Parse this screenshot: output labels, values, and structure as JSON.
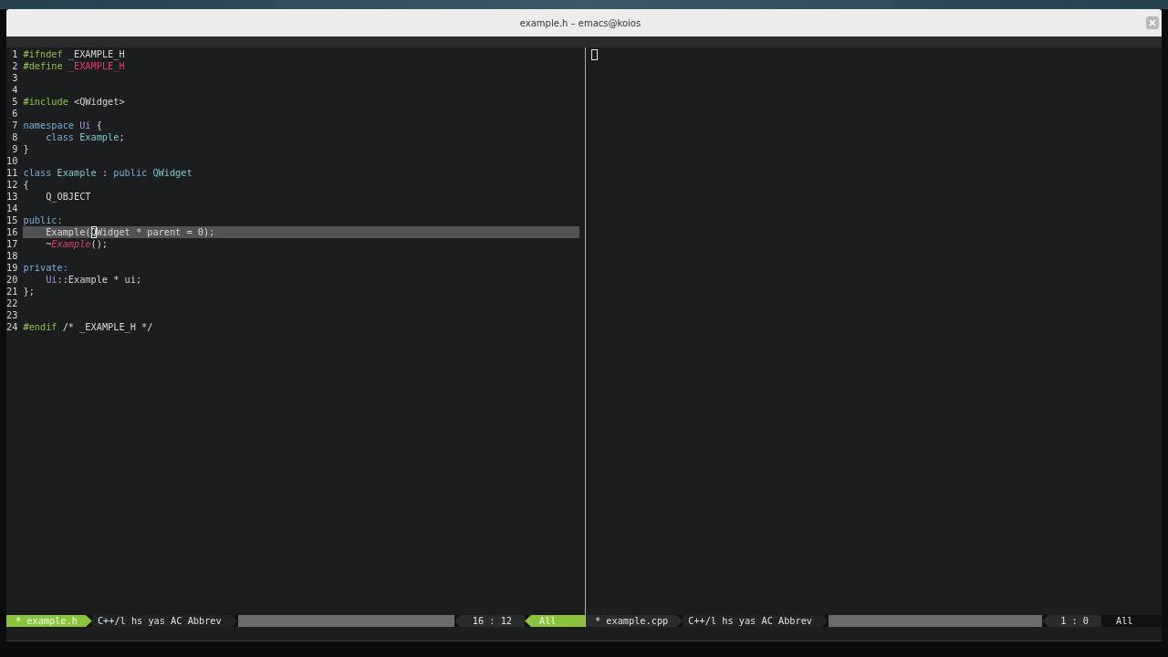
{
  "window": {
    "title": "example.h – emacs@koios"
  },
  "panes": [
    {
      "active": true,
      "lines": [
        {
          "number": "1",
          "indented": false,
          "current": false,
          "tokens": [
            {
              "kind": "preproc",
              "text": "#ifndef"
            },
            {
              "kind": "plain",
              "text": " _EXAMPLE_H"
            }
          ]
        },
        {
          "number": "2",
          "indented": false,
          "current": false,
          "tokens": [
            {
              "kind": "preproc",
              "text": "#define"
            },
            {
              "kind": "constant",
              "text": " _EXAMPLE_H"
            }
          ]
        },
        {
          "number": "3",
          "current": false
        },
        {
          "number": "4",
          "current": false
        },
        {
          "number": "5",
          "indented": false,
          "current": false,
          "tokens": [
            {
              "kind": "preproc",
              "text": "#include"
            },
            {
              "kind": "plain",
              "text": " <QWidget>"
            }
          ]
        },
        {
          "number": "6",
          "current": false
        },
        {
          "number": "7",
          "indented": false,
          "current": false,
          "tokens": [
            {
              "kind": "keyword",
              "text": "namespace"
            },
            {
              "kind": "namespace",
              "text": " Ui"
            },
            {
              "kind": "plain",
              "text": " {"
            }
          ]
        },
        {
          "number": "8",
          "indented": true,
          "current": false,
          "tokens": [
            {
              "kind": "keyword",
              "text": "class"
            },
            {
              "kind": "type",
              "text": " Example"
            },
            {
              "kind": "plain",
              "text": ";"
            }
          ]
        },
        {
          "number": "9",
          "indented": false,
          "current": false,
          "tokens": [
            {
              "kind": "plain",
              "text": "}"
            }
          ]
        },
        {
          "number": "10",
          "current": false
        },
        {
          "number": "11",
          "indented": false,
          "current": false,
          "tokens": [
            {
              "kind": "keyword",
              "text": "class"
            },
            {
              "kind": "type",
              "text": " Example"
            },
            {
              "kind": "plain",
              "text": " :"
            },
            {
              "kind": "keyword",
              "text": " public"
            },
            {
              "kind": "type",
              "text": " QWidget"
            }
          ]
        },
        {
          "number": "12",
          "indented": false,
          "current": false,
          "tokens": [
            {
              "kind": "plain",
              "text": "{"
            }
          ]
        },
        {
          "number": "13",
          "indented": true,
          "current": false,
          "tokens": [
            {
              "kind": "plain",
              "text": "Q_OBJECT"
            }
          ]
        },
        {
          "number": "14",
          "current": false
        },
        {
          "number": "15",
          "indented": false,
          "current": false,
          "tokens": [
            {
              "kind": "keyword",
              "text": "public:"
            }
          ]
        },
        {
          "number": "16",
          "indented": true,
          "current": true,
          "tokens": [
            {
              "kind": "plain",
              "text": "Example("
            },
            {
              "kind": "plain",
              "text": "Q",
              "cursor": true
            },
            {
              "kind": "plain",
              "text": "Widget * parent = 0);"
            }
          ]
        },
        {
          "number": "17",
          "indented": true,
          "current": false,
          "tokens": [
            {
              "kind": "plain",
              "text": "~"
            },
            {
              "kind": "function",
              "text": "Example"
            },
            {
              "kind": "plain",
              "text": "();"
            }
          ]
        },
        {
          "number": "18",
          "current": false
        },
        {
          "number": "19",
          "indented": false,
          "current": false,
          "tokens": [
            {
              "kind": "keyword",
              "text": "private:"
            }
          ]
        },
        {
          "number": "20",
          "indented": true,
          "current": false,
          "tokens": [
            {
              "kind": "namespace",
              "text": "Ui"
            },
            {
              "kind": "plain",
              "text": "::Example * ui;"
            }
          ]
        },
        {
          "number": "21",
          "indented": false,
          "current": false,
          "tokens": [
            {
              "kind": "plain",
              "text": "};"
            }
          ]
        },
        {
          "number": "22",
          "current": false
        },
        {
          "number": "23",
          "current": false
        },
        {
          "number": "24",
          "indented": false,
          "current": false,
          "tokens": [
            {
              "kind": "preproc",
              "text": "#endif"
            },
            {
              "kind": "plain",
              "text": " /* _EXAMPLE_H */"
            }
          ]
        }
      ],
      "mode_line": {
        "buffer": "* example.h",
        "modes": "C++/l hs yas AC Abbrev",
        "position": "16 : 12",
        "scroll": "All"
      }
    },
    {
      "active": false,
      "cursor": true,
      "mode_line": {
        "buffer": "* example.cpp",
        "modes": "C++/l hs yas AC Abbrev",
        "position": "1 : 0",
        "scroll": "All"
      }
    }
  ]
}
